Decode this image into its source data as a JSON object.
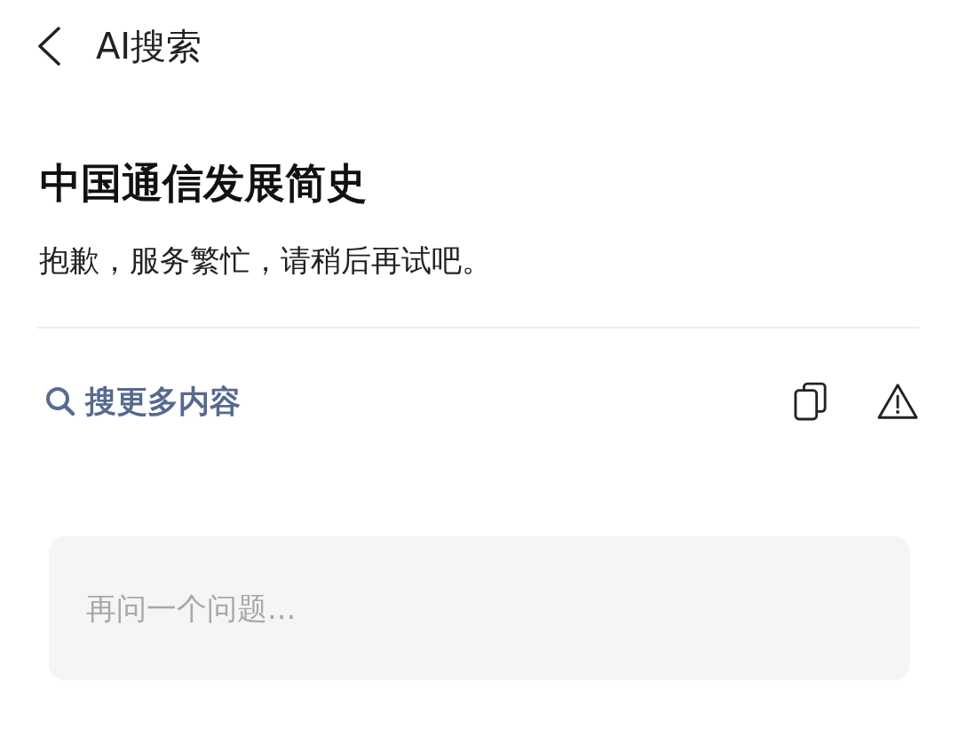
{
  "header": {
    "title": "AI搜索"
  },
  "query": {
    "title": "中国通信发展简史"
  },
  "answer": {
    "text": "抱歉，服务繁忙，请稍后再试吧。"
  },
  "actions": {
    "search_more": "搜更多内容"
  },
  "input": {
    "placeholder": "再问一个问题..."
  }
}
